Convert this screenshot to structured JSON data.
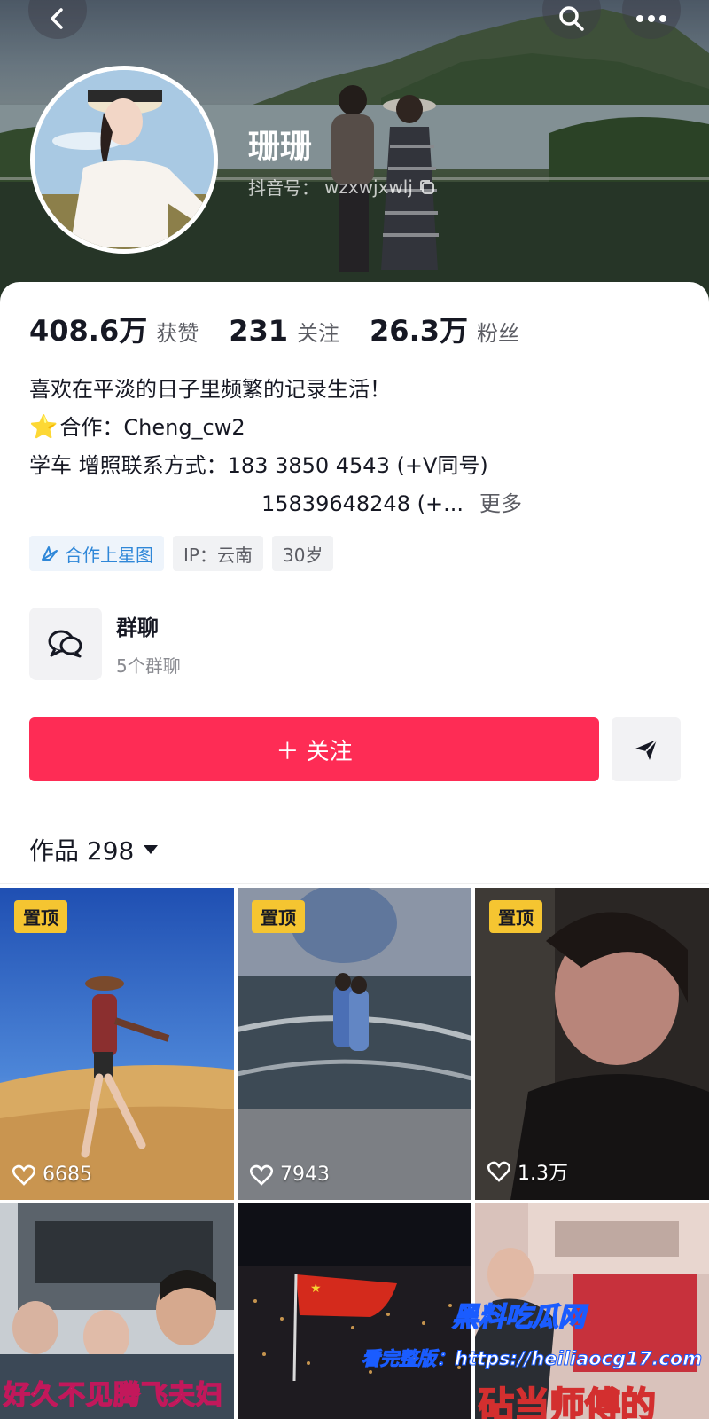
{
  "header": {
    "nickname": "珊珊",
    "douyin_id_label": "抖音号：",
    "douyin_id": "wzxwjxwlj",
    "icons": [
      "back-icon",
      "search-icon",
      "more-icon",
      "copy-icon"
    ]
  },
  "stats": [
    {
      "value": "408.6万",
      "label": "获赞"
    },
    {
      "value": "231",
      "label": "关注"
    },
    {
      "value": "26.3万",
      "label": "粉丝"
    }
  ],
  "bio": {
    "line1": "喜欢在平淡的日子里频繁的记录生活！",
    "line2_star": "⭐",
    "line2": "合作：Cheng_cw2",
    "line3": "学车 增照联系方式：183 3850 4543 (+V同号)",
    "line4": "15839648248 (+...",
    "more": "更多"
  },
  "tags": [
    {
      "label": "合作上星图",
      "icon": "star-chart-icon"
    },
    {
      "label": "IP：云南"
    },
    {
      "label": "30岁"
    }
  ],
  "group_chat": {
    "title": "群聊",
    "subtitle": "5个群聊",
    "icon": "chat-bubbles-icon"
  },
  "actions": {
    "follow_label": "＋ 关注",
    "share_icon": "send-icon",
    "accent": "#fe2c55"
  },
  "works": {
    "tab_label": "作品 298",
    "dropdown_icon": "triangle-down-icon"
  },
  "videos": [
    {
      "pinned": "置顶",
      "likes": "6685"
    },
    {
      "pinned": "置顶",
      "likes": "7943"
    },
    {
      "pinned": "置顶",
      "likes": "1.3万"
    },
    {
      "caption": "好久不见腾飞夫妇"
    },
    {},
    {
      "caption": "砧当师傅的"
    }
  ],
  "watermark": {
    "title": "黑料吃瓜网",
    "url": "看完整版：https://heiliaocg17.com"
  }
}
